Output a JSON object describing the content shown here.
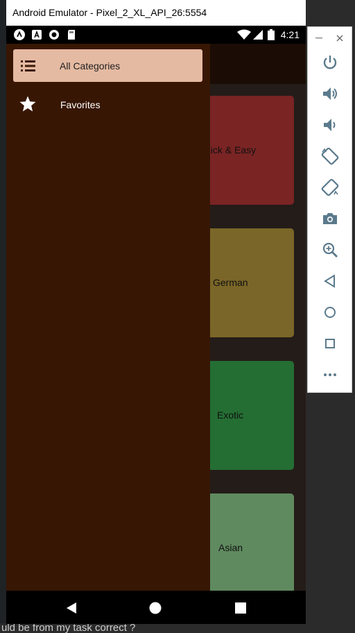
{
  "window": {
    "title": "Android Emulator - Pixel_2_XL_API_26:5554"
  },
  "status_bar": {
    "time": "4:21",
    "notification_icons": [
      "app-a-icon",
      "font-a-icon",
      "circle-dot-icon",
      "sd-card-icon"
    ],
    "right_icons": [
      "wifi-icon",
      "cell-signal-icon",
      "battery-icon"
    ]
  },
  "drawer": {
    "items": [
      {
        "label": "All Categories",
        "icon": "list-icon",
        "selected": true
      },
      {
        "label": "Favorites",
        "icon": "star-icon",
        "selected": false
      }
    ]
  },
  "categories": [
    {
      "label": "Quick & Easy",
      "visible_label": "uick & Easy",
      "color": "#7a2424"
    },
    {
      "label": "German",
      "visible_label": "German",
      "color": "#7a6628"
    },
    {
      "label": "Exotic",
      "visible_label": "Exotic",
      "color": "#246e33"
    },
    {
      "label": "Asian",
      "visible_label": "Asian",
      "color": "#5f8a5f"
    }
  ],
  "side_toolbar": {
    "buttons": [
      "minimize-icon",
      "close-icon",
      "power-icon",
      "volume-up-icon",
      "volume-down-icon",
      "rotate-left-icon",
      "rotate-right-icon",
      "camera-icon",
      "zoom-icon",
      "back-icon",
      "home-icon",
      "overview-icon",
      "more-icon"
    ]
  },
  "background": {
    "bottom_text": "uld be from my task correct ?"
  },
  "colors": {
    "drawer_bg": "#371604",
    "drawer_selected": "#e5baa2",
    "appbar": "#1b0d05",
    "content_bg": "#241c19"
  }
}
